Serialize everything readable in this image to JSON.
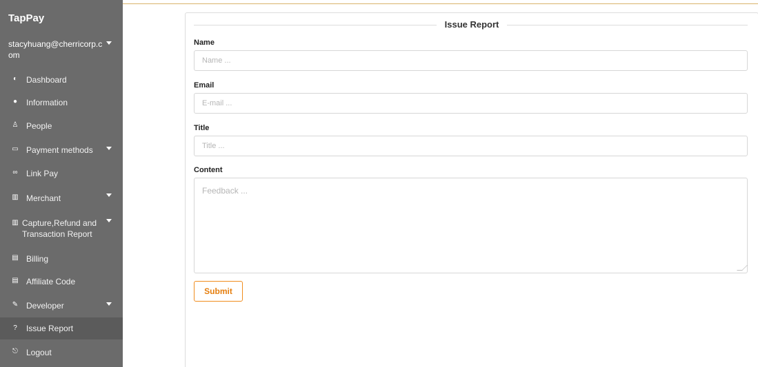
{
  "app": {
    "brand": "TapPay"
  },
  "sidebar": {
    "user": "stacyhuang@cherricorp.com",
    "items": [
      {
        "label": "Dashboard",
        "icon": "dashboard-icon"
      },
      {
        "label": "Information",
        "icon": "info-icon"
      },
      {
        "label": "People",
        "icon": "people-icon"
      },
      {
        "label": "Payment methods",
        "icon": "card-icon"
      },
      {
        "label": "Link Pay",
        "icon": "link-icon"
      },
      {
        "label": "Merchant",
        "icon": "building-icon"
      },
      {
        "label": "Capture,Refund and Transaction Report",
        "icon": "building-icon"
      },
      {
        "label": "Billing",
        "icon": "document-icon"
      },
      {
        "label": "Affiliate Code",
        "icon": "document-icon"
      },
      {
        "label": "Developer",
        "icon": "wrench-icon"
      },
      {
        "label": "Issue Report",
        "icon": "question-icon"
      },
      {
        "label": "Logout",
        "icon": "logout-icon"
      }
    ]
  },
  "form": {
    "title": "Issue Report",
    "name_label": "Name",
    "name_placeholder": "Name ...",
    "email_label": "Email",
    "email_placeholder": "E-mail ...",
    "title_label": "Title",
    "title_placeholder": "Title ...",
    "content_label": "Content",
    "content_placeholder": "Feedback ...",
    "submit_label": "Submit"
  },
  "colors": {
    "sidebar_bg": "#6b6b6b",
    "accent": "#f08c1c"
  }
}
